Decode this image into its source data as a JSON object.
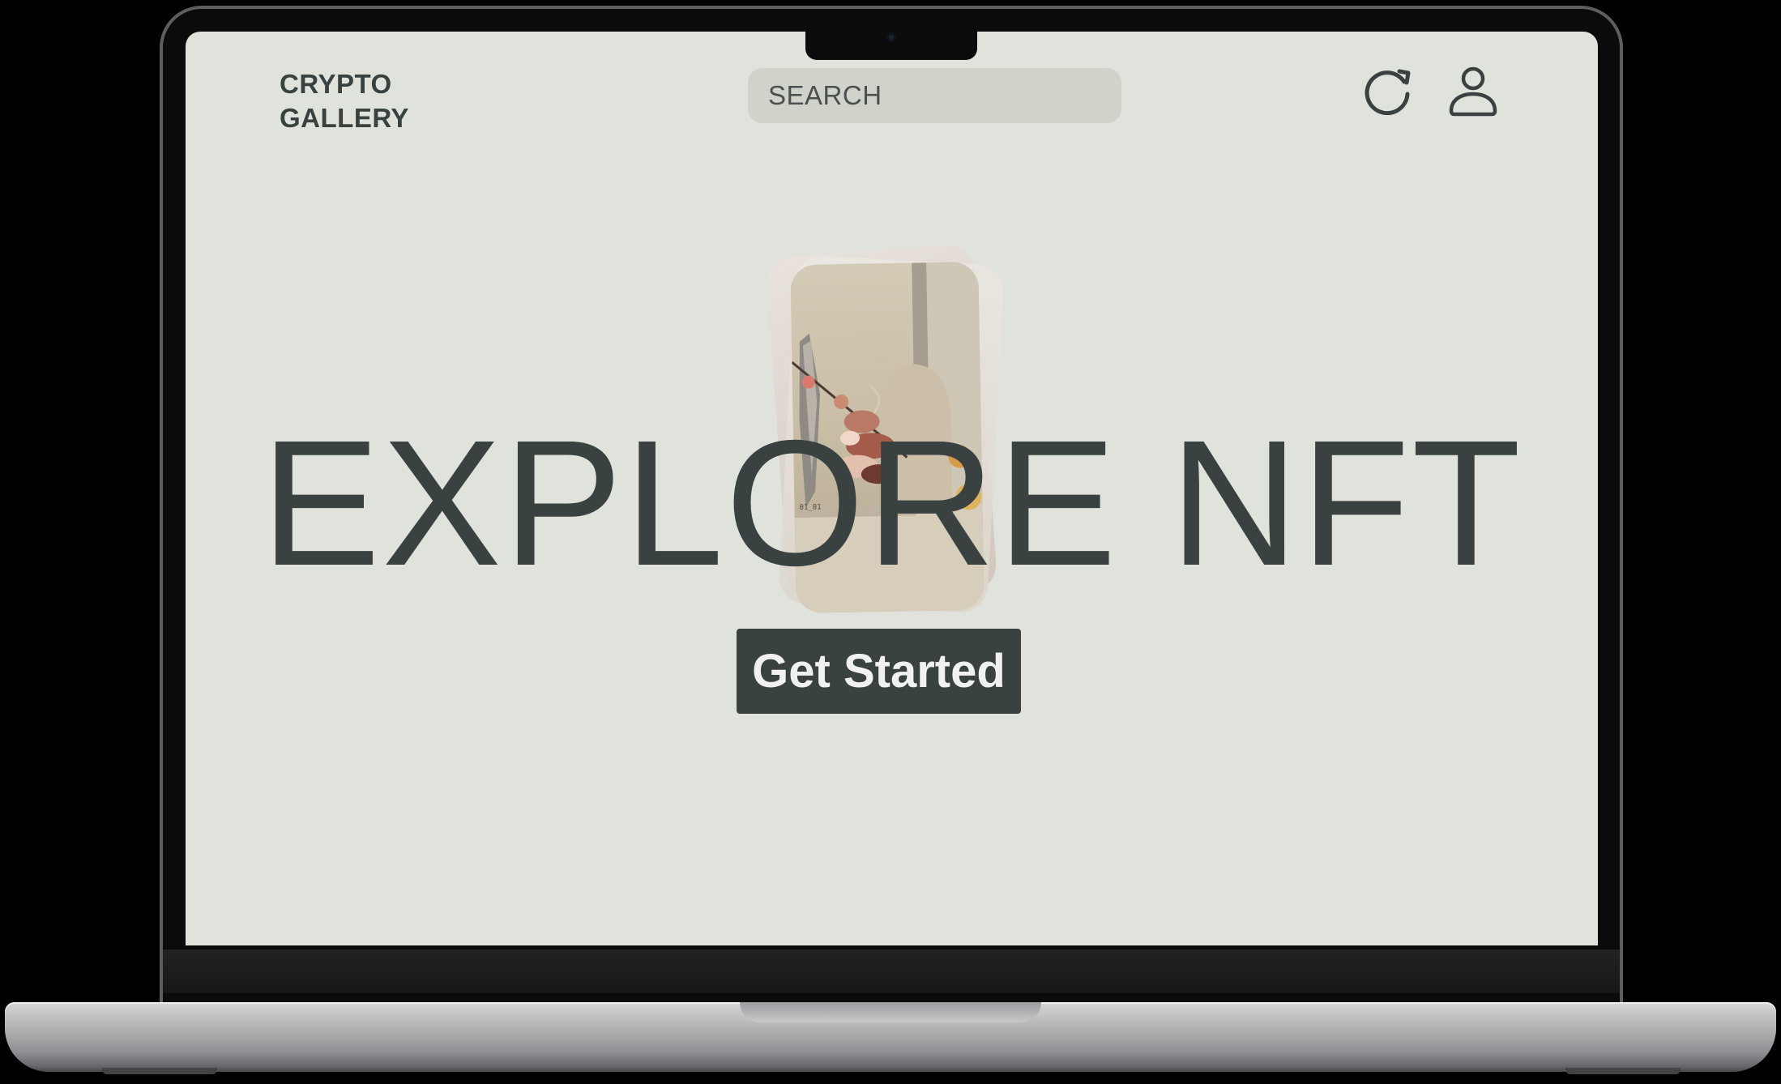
{
  "header": {
    "logo_line1": "CRYPTO",
    "logo_line2": "GALLERY",
    "search_placeholder": "SEARCH",
    "refresh_icon": "refresh-icon",
    "profile_icon": "user-icon"
  },
  "hero": {
    "headline": "EXPLORE NFT",
    "cta_label": "Get Started",
    "artwork": "nft-card-stack-image"
  },
  "colors": {
    "background": "#e0e3dc",
    "text_dark": "#394241",
    "search_bg": "#d1d3ca",
    "cta_bg": "#394241",
    "cta_text": "#f1f2ef"
  }
}
